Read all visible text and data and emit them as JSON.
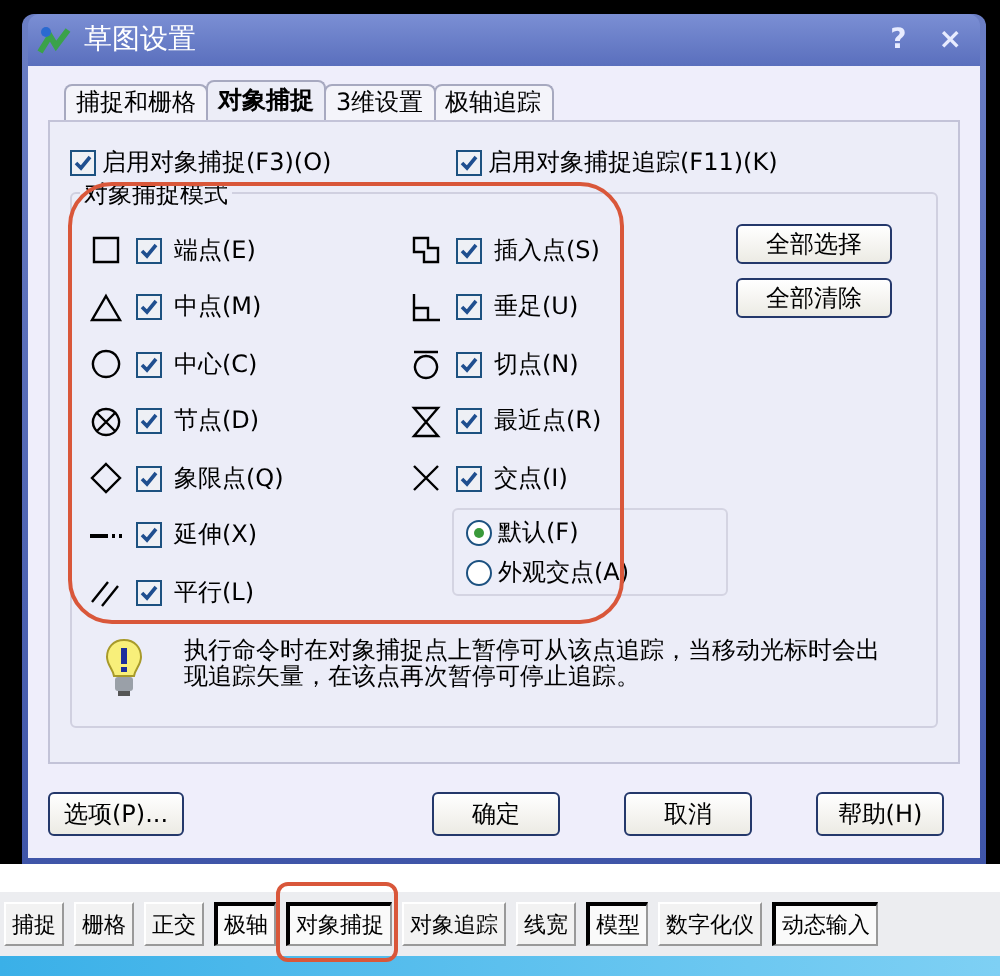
{
  "window": {
    "title": "草图设置",
    "title_buttons": [
      "?",
      "×"
    ]
  },
  "tabs": [
    {
      "label": "捕捉和栅格",
      "selected": false
    },
    {
      "label": "对象捕捉",
      "selected": true
    },
    {
      "label": "3维设置",
      "selected": false
    },
    {
      "label": "极轴追踪",
      "selected": false
    }
  ],
  "enable_options": [
    {
      "label": "启用对象捕捉(F3)(O)",
      "checked": true
    },
    {
      "label": "启用对象捕捉追踪(F11)(K)",
      "checked": true
    }
  ],
  "snap_modes": {
    "title": "对象捕捉模式",
    "left": [
      {
        "kind": "endpoint",
        "label": "端点(E)",
        "checked": true
      },
      {
        "kind": "midpoint",
        "label": "中点(M)",
        "checked": true
      },
      {
        "kind": "center",
        "label": "中心(C)",
        "checked": true
      },
      {
        "kind": "node",
        "label": "节点(D)",
        "checked": true
      },
      {
        "kind": "quadrant",
        "label": "象限点(Q)",
        "checked": true
      },
      {
        "kind": "extension",
        "label": "延伸(X)",
        "checked": true
      },
      {
        "kind": "parallel",
        "label": "平行(L)",
        "checked": true
      }
    ],
    "right": [
      {
        "kind": "insertion",
        "label": "插入点(S)",
        "checked": true
      },
      {
        "kind": "perpendicular",
        "label": "垂足(U)",
        "checked": true
      },
      {
        "kind": "tangent",
        "label": "切点(N)",
        "checked": true
      },
      {
        "kind": "nearest",
        "label": "最近点(R)",
        "checked": true
      },
      {
        "kind": "intersection",
        "label": "交点(I)",
        "checked": true
      }
    ],
    "intersection_types": [
      {
        "label": "默认(F)",
        "selected": true
      },
      {
        "label": "外观交点(A)",
        "selected": false
      }
    ],
    "side_buttons": [
      "全部选择",
      "全部清除"
    ]
  },
  "hint": "执行命令时在对象捕捉点上暂停可从该点追踪，当移动光标时会出现追踪矢量，在该点再次暂停可停止追踪。",
  "buttons": [
    "选项(P)...",
    "确定",
    "取消",
    "帮助(H)"
  ],
  "status_bar": [
    {
      "label": "捕捉",
      "pressed": false
    },
    {
      "label": "栅格",
      "pressed": false
    },
    {
      "label": "正交",
      "pressed": false
    },
    {
      "label": "极轴",
      "pressed": true
    },
    {
      "label": "对象捕捉",
      "pressed": true
    },
    {
      "label": "对象追踪",
      "pressed": false
    },
    {
      "label": "线宽",
      "pressed": false
    },
    {
      "label": "模型",
      "pressed": true
    },
    {
      "label": "数字化仪",
      "pressed": false
    },
    {
      "label": "动态输入",
      "pressed": true
    }
  ]
}
